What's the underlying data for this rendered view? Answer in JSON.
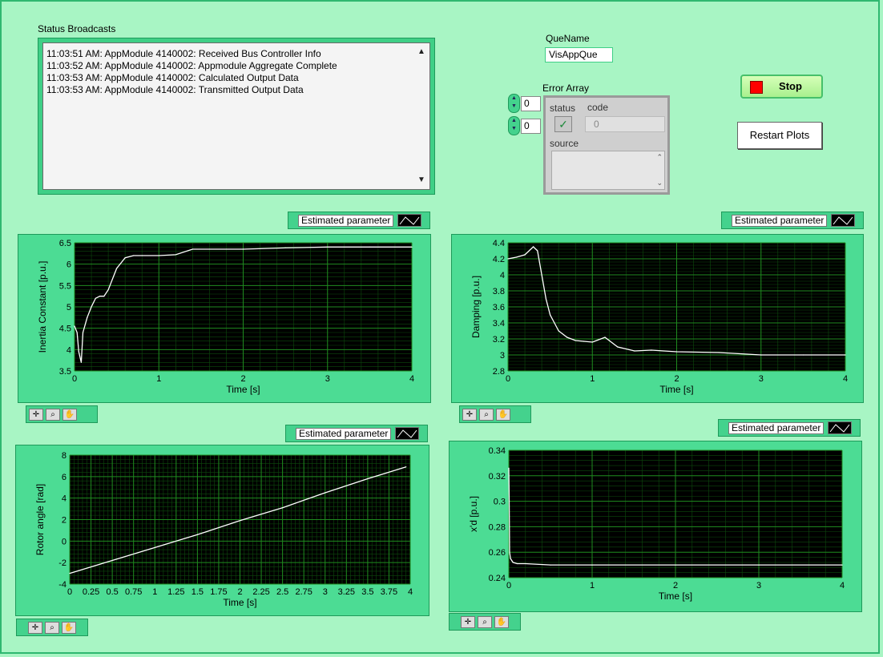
{
  "status": {
    "label": "Status Broadcasts",
    "lines": [
      "11:03:51 AM: AppModule 4140002: Received Bus Controller Info",
      "11:03:52 AM: AppModule 4140002: Appmodule Aggregate Complete",
      "11:03:53 AM: AppModule 4140002: Calculated Output Data",
      "11:03:53 AM: AppModule 4140002: Transmitted Output Data"
    ]
  },
  "quename": {
    "label": "QueName",
    "value": "VisAppQue"
  },
  "error_array": {
    "label": "Error Array",
    "index1": "0",
    "index2": "0",
    "status_label": "status",
    "code_label": "code",
    "code_value": "0",
    "source_label": "source"
  },
  "buttons": {
    "stop": "Stop",
    "restart": "Restart Plots"
  },
  "colors": {
    "background": "#a8f5c4",
    "plot_bg": "#000000",
    "grid": "#1f8a1f",
    "trace": "#ffffff",
    "stop_indicator": "#ff0000"
  },
  "icons": {
    "cursor": "crosshair-icon",
    "zoom": "zoom-icon",
    "pan": "hand-icon"
  },
  "chart_data": [
    {
      "type": "line",
      "legend": "Estimated parameter",
      "xlabel": "Time [s]",
      "ylabel": "Inertia Constant [p.u.]",
      "xlim": [
        0,
        4
      ],
      "ylim": [
        3.5,
        6.5
      ],
      "xticks": [
        "0",
        "1",
        "2",
        "3",
        "4"
      ],
      "yticks": [
        "3.5",
        "4",
        "4.5",
        "5",
        "5.5",
        "6",
        "6.5"
      ],
      "x": [
        0,
        0.03,
        0.05,
        0.08,
        0.1,
        0.15,
        0.2,
        0.25,
        0.3,
        0.35,
        0.4,
        0.5,
        0.6,
        0.7,
        0.8,
        1.0,
        1.2,
        1.4,
        2.0,
        2.5,
        3.0,
        3.5,
        4.0
      ],
      "y": [
        4.55,
        4.4,
        3.95,
        3.7,
        4.4,
        4.75,
        5.0,
        5.2,
        5.25,
        5.25,
        5.4,
        5.9,
        6.15,
        6.2,
        6.2,
        6.2,
        6.22,
        6.35,
        6.35,
        6.38,
        6.4,
        6.4,
        6.4
      ]
    },
    {
      "type": "line",
      "legend": "Estimated parameter",
      "xlabel": "Time [s]",
      "ylabel": "Damping [p.u.]",
      "xlim": [
        0,
        4
      ],
      "ylim": [
        2.8,
        4.4
      ],
      "xticks": [
        "0",
        "1",
        "2",
        "3",
        "4"
      ],
      "yticks": [
        "2.8",
        "3",
        "3.2",
        "3.4",
        "3.6",
        "3.8",
        "4",
        "4.2",
        "4.4"
      ],
      "x": [
        0,
        0.1,
        0.2,
        0.3,
        0.35,
        0.4,
        0.45,
        0.5,
        0.55,
        0.6,
        0.7,
        0.8,
        0.9,
        1.0,
        1.1,
        1.15,
        1.2,
        1.3,
        1.5,
        1.7,
        2.0,
        2.5,
        3.0,
        3.5,
        4.0
      ],
      "y": [
        4.2,
        4.22,
        4.25,
        4.35,
        4.3,
        4.0,
        3.7,
        3.5,
        3.4,
        3.3,
        3.22,
        3.18,
        3.17,
        3.16,
        3.2,
        3.22,
        3.18,
        3.1,
        3.05,
        3.06,
        3.04,
        3.03,
        3.0,
        3.0,
        3.0
      ]
    },
    {
      "type": "line",
      "legend": "Estimated parameter",
      "xlabel": "Time [s]",
      "ylabel": "Rotor angle [rad]",
      "xlim": [
        0,
        4
      ],
      "ylim": [
        -4,
        8
      ],
      "xticks": [
        "0",
        "0.25",
        "0.5",
        "0.75",
        "1",
        "1.25",
        "1.5",
        "1.75",
        "2",
        "2.25",
        "2.5",
        "2.75",
        "3",
        "3.25",
        "3.5",
        "3.75",
        "4"
      ],
      "yticks": [
        "-4",
        "-2",
        "0",
        "2",
        "4",
        "6",
        "8"
      ],
      "x": [
        0,
        0.5,
        1.0,
        1.5,
        2.0,
        2.5,
        3.0,
        3.5,
        3.95
      ],
      "y": [
        -3.0,
        -1.8,
        -0.6,
        0.6,
        1.9,
        3.1,
        4.5,
        5.8,
        6.9
      ]
    },
    {
      "type": "line",
      "legend": "Estimated parameter",
      "xlabel": "Time [s]",
      "ylabel": "x'd [p.u.]",
      "xlim": [
        0,
        4
      ],
      "ylim": [
        0.24,
        0.34
      ],
      "xticks": [
        "0",
        "1",
        "2",
        "3",
        "4"
      ],
      "yticks": [
        "0.24",
        "0.26",
        "0.28",
        "0.3",
        "0.32",
        "0.34"
      ],
      "x": [
        0,
        0.005,
        0.01,
        0.02,
        0.05,
        0.1,
        0.2,
        0.5,
        1.0,
        2.0,
        3.0,
        4.0
      ],
      "y": [
        0.326,
        0.3,
        0.26,
        0.255,
        0.252,
        0.251,
        0.251,
        0.25,
        0.25,
        0.25,
        0.25,
        0.25
      ]
    }
  ]
}
